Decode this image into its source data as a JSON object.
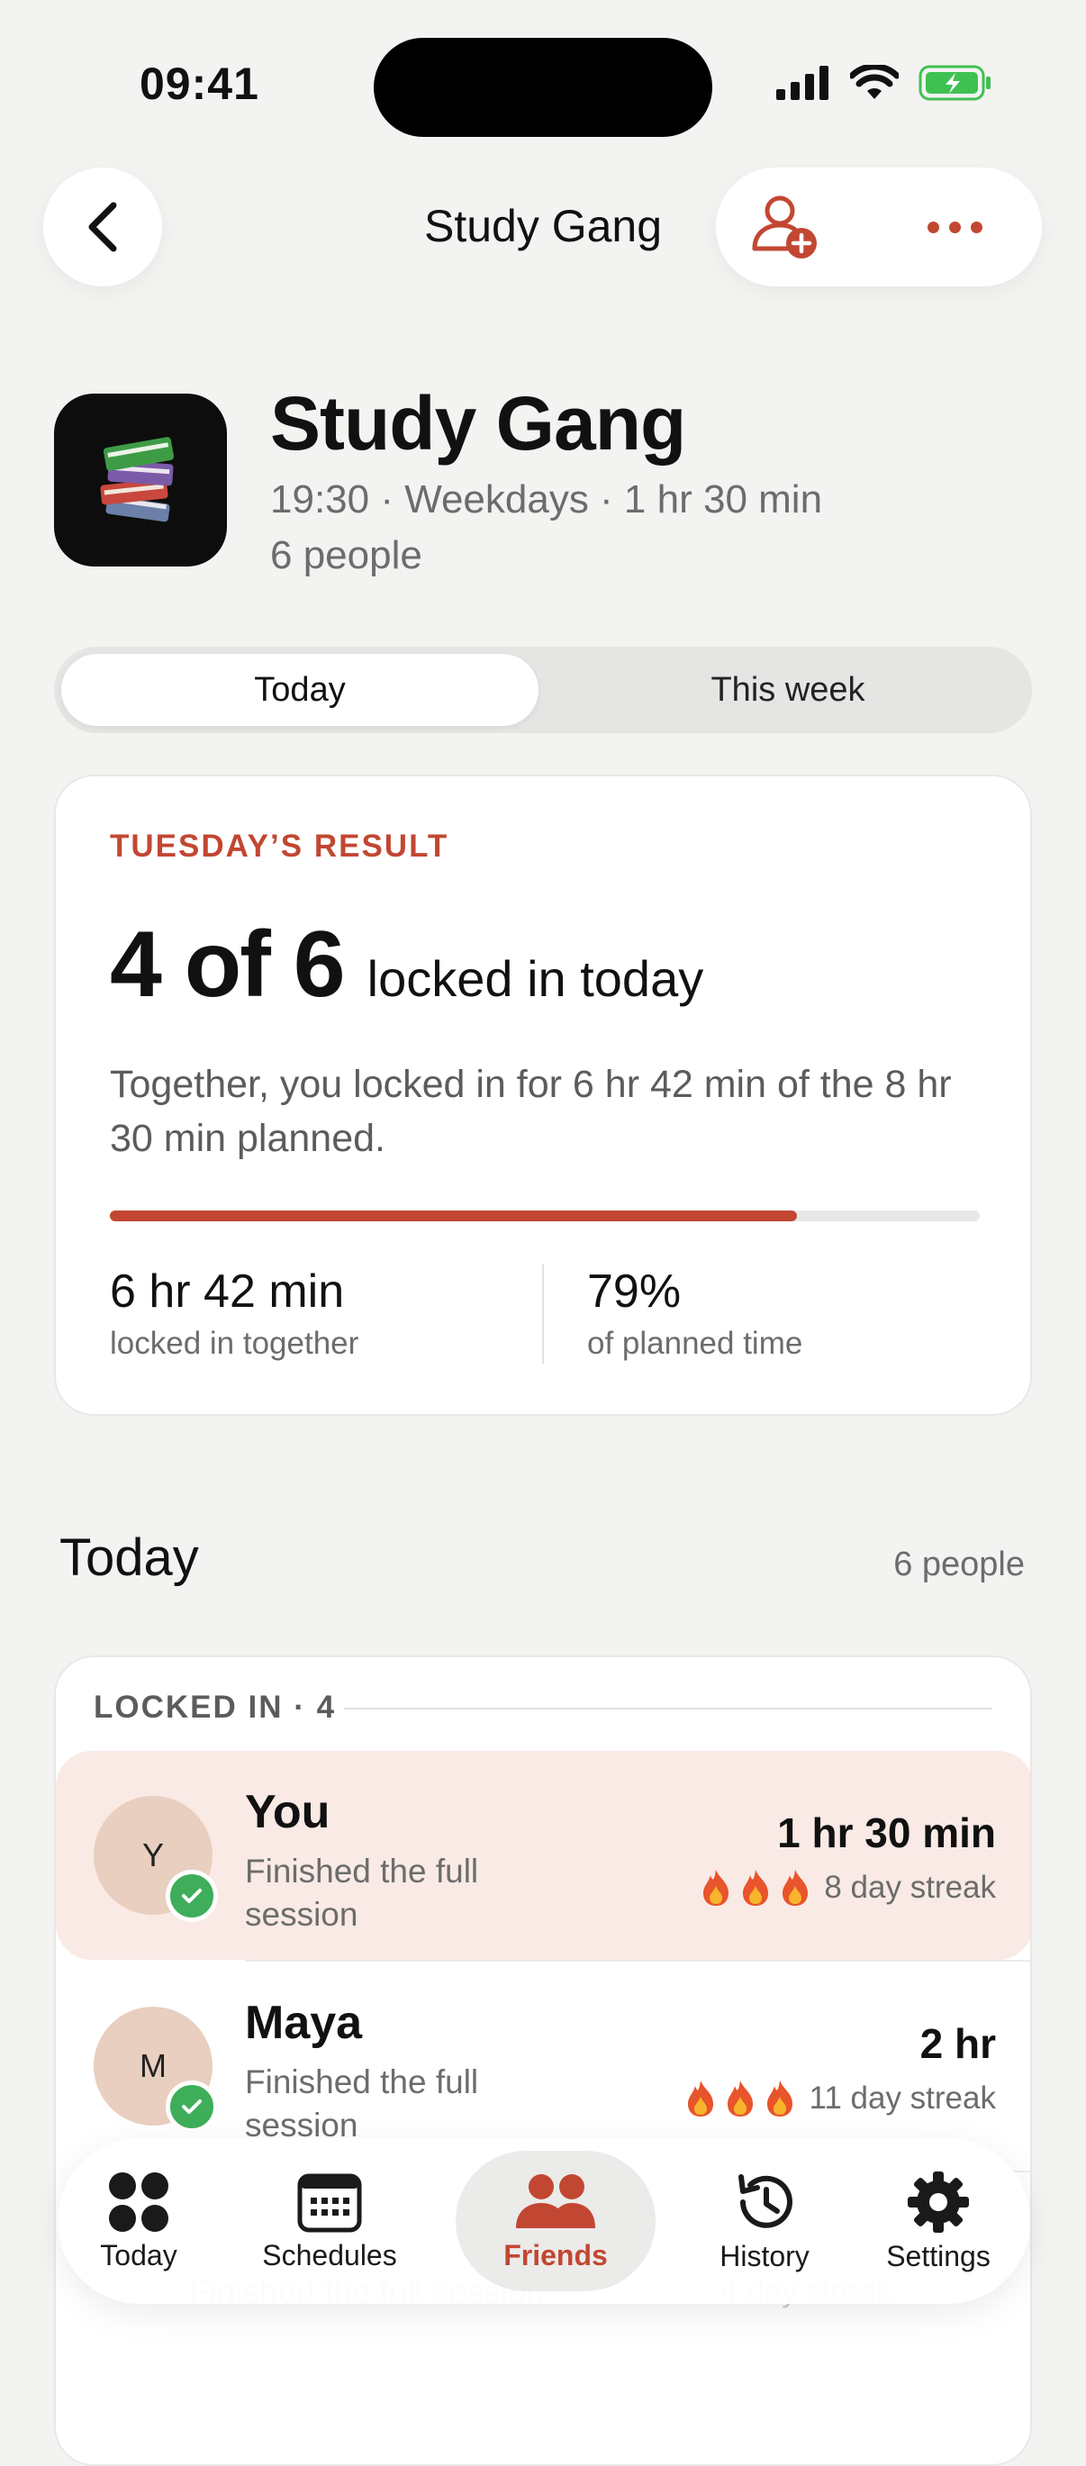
{
  "status_bar": {
    "time": "09:41"
  },
  "nav": {
    "title": "Study Gang"
  },
  "group": {
    "emoji": "📚",
    "title": "Study Gang",
    "meta": "19:30 · Weekdays · 1 hr 30 min",
    "people": "6 people"
  },
  "segmented": {
    "tabs": [
      "Today",
      "This week"
    ],
    "selected": "Today"
  },
  "result": {
    "kicker": "TUESDAY’S RESULT",
    "count": "4 of 6",
    "count_suffix": "locked in today",
    "description": "Together, you locked in for 6 hr 42 min of the 8 hr 30 min planned.",
    "progress_fraction": 0.79,
    "stat1_value": "6 hr 42 min",
    "stat1_label": "locked in together",
    "stat2_value": "79%",
    "stat2_label": "of planned time"
  },
  "today": {
    "heading": "Today",
    "count": "6 people",
    "locked_kicker": "LOCKED IN · 4",
    "members": [
      {
        "initial": "Y",
        "name": "You",
        "status": "Finished the full session",
        "time": "1 hr 30 min",
        "streak": "8 day streak"
      },
      {
        "initial": "M",
        "name": "Maya",
        "status": "Finished the full session",
        "time": "2 hr",
        "streak": "11 day streak"
      }
    ],
    "faded_status": "Finished the full session",
    "faded_streak": "4 day streak"
  },
  "tabbar": {
    "items": [
      {
        "label": "Today",
        "icon": "grid-icon"
      },
      {
        "label": "Schedules",
        "icon": "calendar-icon"
      },
      {
        "label": "Friends",
        "icon": "people-icon"
      },
      {
        "label": "History",
        "icon": "history-icon"
      },
      {
        "label": "Settings",
        "icon": "gear-icon"
      }
    ],
    "selected": "Friends"
  },
  "colors": {
    "accent": "#C24732",
    "background": "#F3F3F1",
    "highlight_row": "#F9EAE5",
    "check_green": "#3EAE5A",
    "battery_green": "#3FC152"
  }
}
